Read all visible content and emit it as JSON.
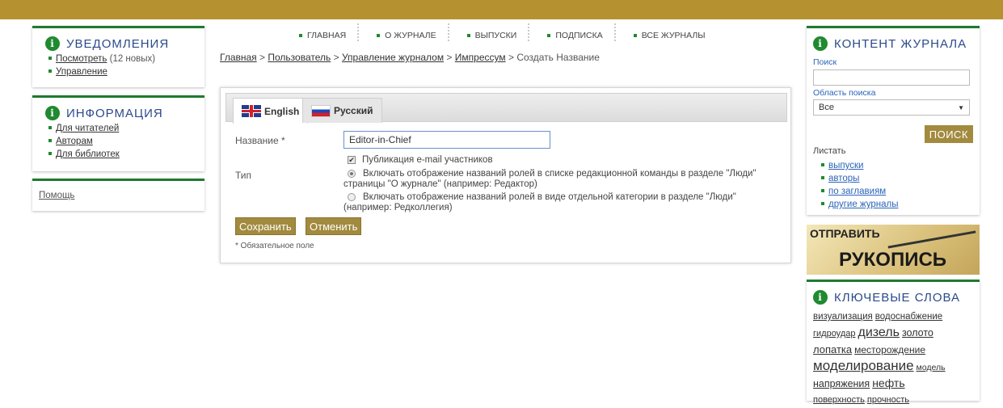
{
  "nav": {
    "items": [
      "ГЛАВНАЯ",
      "О ЖУРНАЛЕ",
      "ВЫПУСКИ",
      "ПОДПИСКА",
      "ВСЕ ЖУРНАЛЫ"
    ]
  },
  "breadcrumb": {
    "crumbs": [
      "Главная",
      "Пользователь",
      "Управление журналом",
      "Импрессум"
    ],
    "sep": ">",
    "current": "Создать Название"
  },
  "left": {
    "notifications": {
      "title": "УВЕДОМЛЕНИЯ",
      "view": "Посмотреть",
      "view_count": "(12 новых)",
      "manage": "Управление"
    },
    "information": {
      "title": "ИНФОРМАЦИЯ",
      "items": [
        "Для читателей",
        "Авторам",
        "Для библиотек"
      ]
    },
    "help": "Помощь"
  },
  "form": {
    "tabs": [
      "English",
      "Русский"
    ],
    "name_label": "Название *",
    "name_value": "Editor-in-Chief",
    "public_email": "Публикация e-mail участников",
    "type_label": "Тип",
    "option1": "Включать отображение названий ролей в списке редакционной команды в разделе \"Люди\" страницы \"О журнале\" (например: Редактор)",
    "option2": "Включать отображение названий ролей в виде отдельной категории в разделе \"Люди\" (например: Редколлегия)",
    "save": "Сохранить",
    "cancel": "Отменить",
    "required_note": "* Обязательное поле"
  },
  "right": {
    "content": {
      "title": "КОНТЕНТ ЖУРНАЛА",
      "search_label": "Поиск",
      "scope_label": "Область поиска",
      "scope_value": "Все",
      "search_button": "ПОИСК",
      "browse_label": "Листать",
      "browse_items": [
        "выпуски",
        "авторы",
        "по заглавиям",
        "другие журналы"
      ]
    },
    "submit_banner": {
      "line1": "ОТПРАВИТЬ",
      "line2": "РУКОПИСЬ"
    },
    "keywords": {
      "title": "КЛЮЧЕВЫЕ СЛОВА",
      "line1": [
        "визуализация",
        "водоснабжение"
      ],
      "line2": [
        "гидроудар",
        "дизель",
        "золото"
      ],
      "line3": [
        "лопатка",
        "месторождение"
      ],
      "line4": [
        "моделирование",
        "модель"
      ],
      "line5": [
        "напряжения",
        "нефть"
      ],
      "line6": [
        "поверхность",
        "прочность"
      ]
    }
  },
  "colors": {
    "topbar": "#b5912f",
    "accent_green": "#1f7a2f",
    "button": "#a28a3e"
  }
}
